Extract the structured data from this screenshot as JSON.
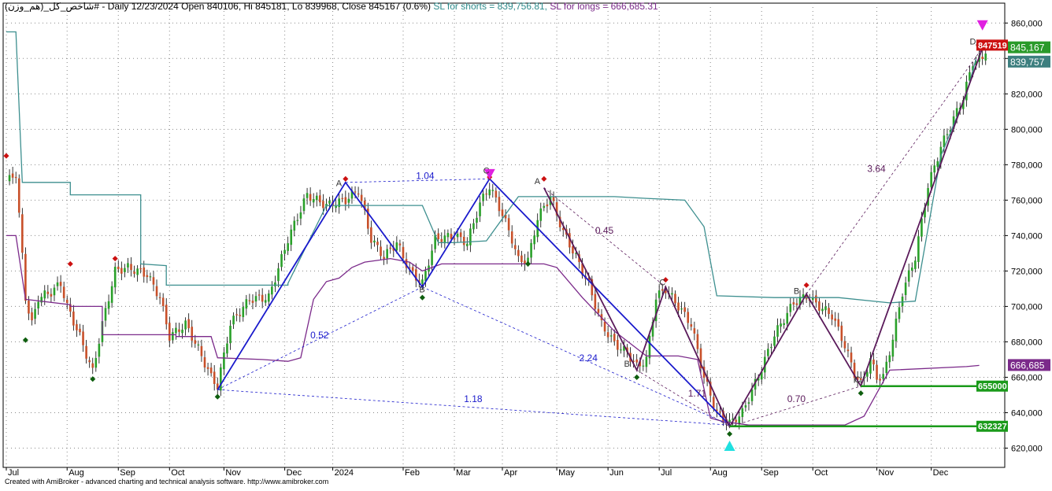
{
  "header": {
    "prefix": "شاخص_کل_(هم_وزن)# - Daily 12/23/2024 Open 840106, Hi 845181, Lo 839968, Close 845167 (0.6%)",
    "sl_shorts": "SL for shorts = 839,756.81,",
    "sl_longs": "SL for longs = 666,685.31"
  },
  "footer": "Created with AmiBroker - advanced charting and technical analysis software. http://www.amibroker.com",
  "colors": {
    "bull": "#2aa02a",
    "bear": "#c8502a",
    "sl_short": "#3d8f8f",
    "sl_long": "#7b2a8a",
    "pattern_blue": "#1a1acc",
    "pattern_purple": "#5a1a5a",
    "support": "#1a9a1a",
    "tag_red": "#cc1111",
    "tag_green": "#1a9a1a",
    "tag_teal": "#3d7f7f",
    "tag_purple": "#7b2a8a"
  },
  "chart_data": {
    "type": "candlestick",
    "ylim": [
      610000,
      865000
    ],
    "y_ticks": [
      620000,
      640000,
      660000,
      680000,
      700000,
      720000,
      740000,
      760000,
      780000,
      800000,
      820000,
      840000,
      860000
    ],
    "y_tick_labels": [
      "620,000",
      "640,000",
      "660,000",
      "680,000",
      "700,000",
      "720,000",
      "740,000",
      "760,000",
      "780,000",
      "800,000",
      "820,000",
      "840,000",
      "860,000"
    ],
    "months": [
      {
        "label": "Jul",
        "idx": 0
      },
      {
        "label": "Aug",
        "idx": 19
      },
      {
        "label": "Sep",
        "idx": 35
      },
      {
        "label": "Oct",
        "idx": 51
      },
      {
        "label": "Nov",
        "idx": 68
      },
      {
        "label": "Dec",
        "idx": 87
      },
      {
        "label": "2024",
        "idx": 102
      },
      {
        "label": "Feb",
        "idx": 124
      },
      {
        "label": "Mar",
        "idx": 140
      },
      {
        "label": "Apr",
        "idx": 155
      },
      {
        "label": "May",
        "idx": 172
      },
      {
        "label": "Jun",
        "idx": 188
      },
      {
        "label": "Jul",
        "idx": 204
      },
      {
        "label": "Aug",
        "idx": 220
      },
      {
        "label": "Sep",
        "idx": 236
      },
      {
        "label": "Oct",
        "idx": 252
      },
      {
        "label": "Nov",
        "idx": 272
      },
      {
        "label": "Dec",
        "idx": 289
      }
    ],
    "anchors": [
      [
        0,
        770000
      ],
      [
        3,
        775000
      ],
      [
        6,
        705000
      ],
      [
        8,
        690000
      ],
      [
        10,
        705000
      ],
      [
        14,
        708000
      ],
      [
        17,
        713000
      ],
      [
        19,
        700000
      ],
      [
        23,
        683000
      ],
      [
        27,
        663000
      ],
      [
        30,
        690000
      ],
      [
        34,
        720000
      ],
      [
        38,
        722000
      ],
      [
        44,
        718000
      ],
      [
        48,
        705000
      ],
      [
        51,
        683000
      ],
      [
        56,
        690000
      ],
      [
        60,
        676000
      ],
      [
        64,
        660000
      ],
      [
        66,
        655000
      ],
      [
        70,
        690000
      ],
      [
        76,
        704000
      ],
      [
        82,
        705000
      ],
      [
        88,
        738000
      ],
      [
        94,
        763000
      ],
      [
        100,
        757000
      ],
      [
        106,
        760000
      ],
      [
        110,
        766000
      ],
      [
        114,
        738000
      ],
      [
        118,
        728000
      ],
      [
        122,
        736000
      ],
      [
        126,
        720000
      ],
      [
        130,
        713000
      ],
      [
        134,
        738000
      ],
      [
        140,
        740000
      ],
      [
        144,
        736000
      ],
      [
        148,
        758000
      ],
      [
        151,
        768000
      ],
      [
        155,
        752000
      ],
      [
        158,
        738000
      ],
      [
        160,
        726000
      ],
      [
        163,
        726000
      ],
      [
        166,
        750000
      ],
      [
        170,
        762000
      ],
      [
        174,
        742000
      ],
      [
        178,
        728000
      ],
      [
        182,
        712000
      ],
      [
        186,
        690000
      ],
      [
        190,
        679000
      ],
      [
        194,
        674000
      ],
      [
        197,
        666000
      ],
      [
        200,
        670000
      ],
      [
        203,
        705000
      ],
      [
        206,
        710000
      ],
      [
        210,
        700000
      ],
      [
        214,
        690000
      ],
      [
        218,
        660000
      ],
      [
        222,
        640000
      ],
      [
        226,
        634000
      ],
      [
        230,
        640000
      ],
      [
        236,
        665000
      ],
      [
        240,
        684000
      ],
      [
        246,
        702000
      ],
      [
        250,
        706000
      ],
      [
        254,
        700000
      ],
      [
        258,
        695000
      ],
      [
        262,
        678000
      ],
      [
        265,
        662000
      ],
      [
        267,
        656000
      ],
      [
        270,
        670000
      ],
      [
        272,
        660000
      ],
      [
        274,
        660000
      ],
      [
        277,
        682000
      ],
      [
        280,
        708000
      ],
      [
        284,
        728000
      ],
      [
        288,
        768000
      ],
      [
        292,
        790000
      ],
      [
        296,
        806000
      ],
      [
        299,
        818000
      ],
      [
        302,
        838000
      ],
      [
        305,
        840000
      ],
      [
        306,
        845167
      ]
    ],
    "sl_shorts": [
      [
        0,
        855000
      ],
      [
        3,
        855000
      ],
      [
        5,
        770000
      ],
      [
        20,
        770000
      ],
      [
        20,
        763000
      ],
      [
        42,
        763000
      ],
      [
        42,
        724000
      ],
      [
        50,
        723000
      ],
      [
        50,
        712000
      ],
      [
        88,
        712000
      ],
      [
        88,
        713000
      ],
      [
        100,
        757000
      ],
      [
        105,
        757000
      ],
      [
        110,
        757000
      ],
      [
        130,
        757000
      ],
      [
        135,
        736000
      ],
      [
        140,
        736000
      ],
      [
        150,
        737000
      ],
      [
        160,
        762000
      ],
      [
        180,
        762000
      ],
      [
        190,
        762000
      ],
      [
        200,
        761000
      ],
      [
        212,
        760000
      ],
      [
        218,
        745000
      ],
      [
        222,
        706000
      ],
      [
        240,
        705000
      ],
      [
        260,
        705000
      ],
      [
        276,
        702000
      ],
      [
        284,
        703000
      ],
      [
        292,
        785000
      ],
      [
        300,
        820000
      ],
      [
        303,
        839757
      ]
    ],
    "sl_longs": [
      [
        0,
        740000
      ],
      [
        3,
        740000
      ],
      [
        6,
        704000
      ],
      [
        20,
        701000
      ],
      [
        20,
        700000
      ],
      [
        30,
        700000
      ],
      [
        30,
        684000
      ],
      [
        53,
        684000
      ],
      [
        53,
        683000
      ],
      [
        64,
        683000
      ],
      [
        66,
        671000
      ],
      [
        80,
        670000
      ],
      [
        88,
        669000
      ],
      [
        92,
        671000
      ],
      [
        96,
        704000
      ],
      [
        100,
        714000
      ],
      [
        104,
        716000
      ],
      [
        108,
        722000
      ],
      [
        112,
        725000
      ],
      [
        120,
        727000
      ],
      [
        126,
        725000
      ],
      [
        130,
        720000
      ],
      [
        136,
        724000
      ],
      [
        150,
        724000
      ],
      [
        168,
        724000
      ],
      [
        172,
        722000
      ],
      [
        180,
        705000
      ],
      [
        190,
        686000
      ],
      [
        200,
        672000
      ],
      [
        210,
        672000
      ],
      [
        216,
        670000
      ],
      [
        220,
        637000
      ],
      [
        224,
        635000
      ],
      [
        232,
        633000
      ],
      [
        250,
        633000
      ],
      [
        262,
        633000
      ],
      [
        268,
        638000
      ],
      [
        272,
        651000
      ],
      [
        276,
        664000
      ],
      [
        300,
        666000
      ],
      [
        304,
        666685
      ]
    ],
    "markers_red": [
      [
        0,
        785000
      ],
      [
        20,
        724000
      ],
      [
        34,
        727000
      ],
      [
        106,
        772000
      ],
      [
        151,
        773000
      ],
      [
        168,
        772000
      ],
      [
        206,
        715000
      ],
      [
        250,
        712000
      ]
    ],
    "markers_green": [
      [
        6,
        681000
      ],
      [
        27,
        659000
      ],
      [
        66,
        649000
      ],
      [
        130,
        705000
      ],
      [
        163,
        724000
      ],
      [
        197,
        660000
      ],
      [
        226,
        628000
      ],
      [
        267,
        651000
      ]
    ],
    "triangle_down": [
      [
        151,
        774000
      ],
      [
        305,
        858000
      ]
    ],
    "triangle_up": [
      [
        226,
        622000
      ]
    ],
    "pattern_blue": [
      [
        66,
        653000
      ],
      [
        106,
        770000
      ],
      [
        130,
        711000
      ],
      [
        151,
        772000
      ],
      [
        226,
        633000
      ]
    ],
    "pattern_purple": [
      [
        168,
        767000
      ],
      [
        197,
        664000
      ],
      [
        206,
        711000
      ],
      [
        226,
        632000
      ],
      [
        250,
        707000
      ],
      [
        267,
        655000
      ],
      [
        305,
        846000
      ]
    ],
    "pattern_dotted_blue": [
      [
        [
          66,
          653000
        ],
        [
          130,
          711000
        ]
      ],
      [
        [
          106,
          770000
        ],
        [
          151,
          772000
        ]
      ],
      [
        [
          130,
          711000
        ],
        [
          226,
          633000
        ]
      ],
      [
        [
          66,
          653000
        ],
        [
          226,
          633000
        ]
      ]
    ],
    "pattern_dotted_purple": [
      [
        [
          168,
          767000
        ],
        [
          206,
          711000
        ]
      ],
      [
        [
          197,
          664000
        ],
        [
          226,
          632000
        ]
      ],
      [
        [
          226,
          632000
        ],
        [
          267,
          655000
        ]
      ],
      [
        [
          250,
          707000
        ],
        [
          305,
          846000
        ]
      ]
    ],
    "ratios": [
      {
        "text": "1.04",
        "idx": 128,
        "y": 772000,
        "color": "blue"
      },
      {
        "text": "0.52",
        "idx": 95,
        "y": 682000,
        "color": "blue"
      },
      {
        "text": "2.24",
        "idx": 179,
        "y": 669000,
        "color": "blue"
      },
      {
        "text": "1.18",
        "idx": 143,
        "y": 646000,
        "color": "blue"
      },
      {
        "text": "0.45",
        "idx": 184,
        "y": 741000,
        "color": "purple"
      },
      {
        "text": "1.71",
        "idx": 213,
        "y": 649000,
        "color": "purple"
      },
      {
        "text": "0.70",
        "idx": 244,
        "y": 646000,
        "color": "purple"
      },
      {
        "text": "3.64",
        "idx": 269,
        "y": 776000,
        "color": "purple"
      }
    ],
    "point_labels": [
      {
        "text": "A",
        "idx": 104,
        "y": 768000
      },
      {
        "text": "C",
        "idx": 150,
        "y": 775000
      },
      {
        "text": "A",
        "idx": 166,
        "y": 769000
      },
      {
        "text": "B",
        "idx": 130,
        "y": 708000
      },
      {
        "text": "B",
        "idx": 194,
        "y": 666000
      },
      {
        "text": "C",
        "idx": 205,
        "y": 712000
      },
      {
        "text": "B",
        "idx": 247,
        "y": 707000
      },
      {
        "text": "C",
        "idx": 266,
        "y": 657000
      },
      {
        "text": "D",
        "idx": 302,
        "y": 848000
      }
    ],
    "support_lines": [
      {
        "from": 267,
        "value": 655000,
        "label": "655000"
      },
      {
        "from": 226,
        "value": 632327,
        "label": "632327"
      },
      {
        "from": 303,
        "value": 847519,
        "label": "847519"
      }
    ],
    "price_tags": [
      {
        "value": 845167,
        "label": "845,167",
        "color": "green"
      },
      {
        "value": 839757,
        "label": "839,757",
        "color": "teal"
      },
      {
        "value": 666685,
        "label": "666,685",
        "color": "purple"
      }
    ]
  }
}
